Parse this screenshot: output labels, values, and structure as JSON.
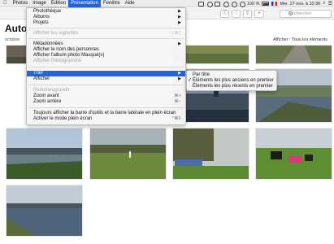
{
  "menubar": {
    "apple": "",
    "items": [
      "Photos",
      "Image",
      "Édition",
      "Présentation",
      "Fenêtre",
      "Aide"
    ],
    "active_index": 3,
    "status": {
      "battery": "100 %",
      "clock": "Mer. 27 nov. à 10:36"
    }
  },
  "toolbar": {
    "search_placeholder": "Rechercher"
  },
  "album": {
    "title": "Auto",
    "date": "octobre",
    "filter": "Afficher : Tous les éléments"
  },
  "menu": {
    "items": [
      {
        "label": "Photothèque",
        "submenu": true,
        "enabled": true
      },
      {
        "label": "Albums",
        "submenu": true,
        "enabled": true
      },
      {
        "label": "Projets",
        "submenu": true,
        "enabled": true
      },
      {
        "label": "Afficher les vignettes",
        "shortcut": "⌥⌘1",
        "enabled": false
      },
      {
        "label": "Métadonnées",
        "submenu": true,
        "enabled": true
      },
      {
        "label": "Afficher le nom des personnes",
        "enabled": true
      },
      {
        "label": "Afficher l'album photo Masqué(s)",
        "enabled": true
      },
      {
        "label": "Afficher l'histogramme",
        "enabled": false
      },
      {
        "label": "Trier",
        "submenu": true,
        "enabled": true,
        "highlighted": true
      },
      {
        "label": "Afficher",
        "submenu": true,
        "enabled": true
      },
      {
        "label": "Réduire/agrandir",
        "enabled": false
      },
      {
        "label": "Zoom avant",
        "shortcut": "⌘+",
        "enabled": true
      },
      {
        "label": "Zoom arrière",
        "shortcut": "⌘−",
        "enabled": true
      },
      {
        "label": "Toujours afficher la barre d'outils et la barre latérale en plein écran",
        "enabled": true
      },
      {
        "label": "Activer le mode plein écran",
        "shortcut": "^⌘F",
        "enabled": true
      }
    ]
  },
  "submenu": {
    "items": [
      {
        "label": "Par titre",
        "checked": false
      },
      {
        "label": "Éléments les plus anciens en premier",
        "checked": true
      },
      {
        "label": "Éléments les plus récents en premier",
        "checked": false
      }
    ]
  },
  "photos": [
    {
      "id": "photo-1",
      "scene": "dusk-field"
    },
    {
      "id": "photo-2",
      "scene": "grass"
    },
    {
      "id": "photo-3",
      "scene": "grass-road"
    },
    {
      "id": "photo-4",
      "scene": "road"
    },
    {
      "id": "photo-5",
      "scene": "dusk-water"
    },
    {
      "id": "photo-6",
      "scene": "river-trees"
    },
    {
      "id": "photo-7",
      "scene": "water-shore"
    },
    {
      "id": "photo-8",
      "scene": "harbour"
    },
    {
      "id": "photo-9",
      "scene": "heron-field"
    },
    {
      "id": "photo-10",
      "scene": "tree-container"
    },
    {
      "id": "photo-11",
      "scene": "horses"
    },
    {
      "id": "photo-12",
      "scene": "shoreline"
    }
  ]
}
